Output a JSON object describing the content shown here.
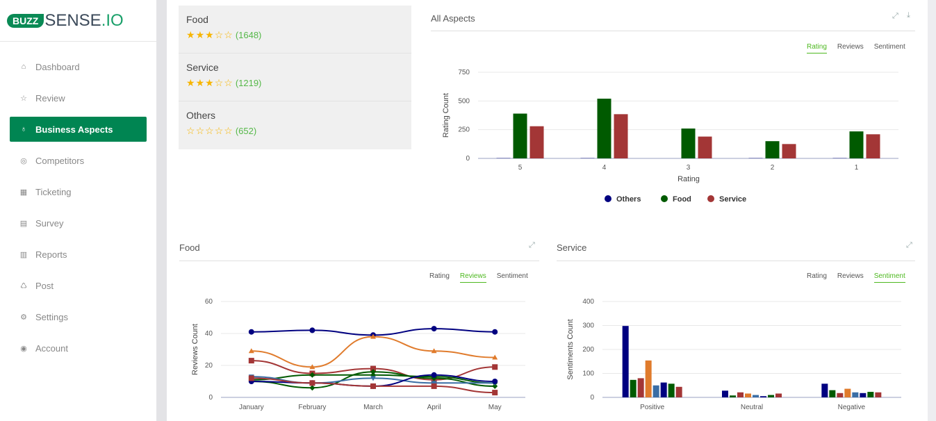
{
  "brand": {
    "badge": "BUZZ",
    "name": "SENSE",
    "tld": ".IO"
  },
  "sidebar": {
    "items": [
      {
        "label": "Dashboard",
        "icon": "home-icon",
        "glyph": "⌂"
      },
      {
        "label": "Review",
        "icon": "star-icon",
        "glyph": "☆"
      },
      {
        "label": "Business Aspects",
        "icon": "lightbulb-icon",
        "glyph": "♁",
        "active": true
      },
      {
        "label": "Competitors",
        "icon": "medal-icon",
        "glyph": "◎"
      },
      {
        "label": "Ticketing",
        "icon": "calculator-icon",
        "glyph": "▦"
      },
      {
        "label": "Survey",
        "icon": "clipboard-icon",
        "glyph": "▤"
      },
      {
        "label": "Reports",
        "icon": "bar-chart-icon",
        "glyph": "▥"
      },
      {
        "label": "Post",
        "icon": "recycle-icon",
        "glyph": "♺"
      },
      {
        "label": "Settings",
        "icon": "gear-icon",
        "glyph": "⚙"
      },
      {
        "label": "Account",
        "icon": "user-circle-icon",
        "glyph": "◉"
      }
    ]
  },
  "aspects": [
    {
      "name": "Food",
      "rating": 3,
      "count": "(1648)"
    },
    {
      "name": "Service",
      "rating": 3,
      "count": "(1219)"
    },
    {
      "name": "Others",
      "rating": 0,
      "count": "(652)"
    }
  ],
  "tab_labels": {
    "rating": "Rating",
    "reviews": "Reviews",
    "sentiment": "Sentiment"
  },
  "panels": {
    "all": {
      "title": "All Aspects",
      "active_tab": "rating"
    },
    "food": {
      "title": "Food",
      "active_tab": "reviews"
    },
    "service": {
      "title": "Service",
      "active_tab": "sentiment"
    }
  },
  "colors": {
    "accent": "#008552",
    "tab_active": "#4db81f",
    "star": "#f7b500"
  },
  "chart_data": [
    {
      "type": "bar",
      "xlabel": "Rating",
      "ylabel": "Rating Count",
      "ylim": [
        0,
        750
      ],
      "yticks": [
        0,
        250,
        500,
        750
      ],
      "grid": true,
      "legend": "bottom",
      "categories": [
        "5",
        "4",
        "3",
        "2",
        "1"
      ],
      "series": [
        {
          "name": "Others",
          "color": "#000080",
          "values": [
            3,
            3,
            0,
            3,
            3
          ]
        },
        {
          "name": "Food",
          "color": "#005a00",
          "values": [
            390,
            520,
            260,
            150,
            235
          ]
        },
        {
          "name": "Service",
          "color": "#a33636",
          "values": [
            280,
            385,
            190,
            125,
            210
          ]
        }
      ]
    },
    {
      "type": "line",
      "ylabel": "Reviews Count",
      "ylim": [
        0,
        60
      ],
      "yticks": [
        0,
        20,
        40,
        60
      ],
      "grid": true,
      "categories": [
        "January",
        "February",
        "March",
        "April",
        "May"
      ],
      "series": [
        {
          "color": "#000080",
          "marker": "circle",
          "values": [
            41,
            42,
            39,
            43,
            41
          ]
        },
        {
          "color": "#e07b2c",
          "marker": "triangle",
          "values": [
            29,
            19,
            38,
            29,
            25
          ]
        },
        {
          "color": "#a33636",
          "marker": "square",
          "values": [
            23,
            15,
            18,
            11,
            19
          ]
        },
        {
          "color": "#005a00",
          "marker": "diamond",
          "values": [
            11,
            14,
            14,
            13,
            9
          ]
        },
        {
          "color": "#005a00",
          "marker": "diamond",
          "values": [
            10,
            6,
            16,
            12,
            7
          ]
        },
        {
          "color": "#3a6ea5",
          "marker": "triangle-down",
          "values": [
            13,
            9,
            12,
            9,
            9
          ]
        },
        {
          "color": "#000080",
          "marker": "circle",
          "values": [
            10,
            9,
            7,
            14,
            10
          ]
        },
        {
          "color": "#a33636",
          "marker": "square",
          "values": [
            12,
            9,
            7,
            7,
            3
          ]
        }
      ]
    },
    {
      "type": "bar",
      "ylabel": "Sentiments Count",
      "ylim": [
        0,
        400
      ],
      "yticks": [
        0,
        100,
        200,
        300,
        400
      ],
      "grid": true,
      "categories": [
        "Positive",
        "Neutral",
        "Negative"
      ],
      "series": [
        {
          "color": "#000080",
          "values": [
            298,
            28,
            57
          ]
        },
        {
          "color": "#005a00",
          "values": [
            73,
            8,
            30
          ]
        },
        {
          "color": "#a33636",
          "values": [
            80,
            21,
            18
          ]
        },
        {
          "color": "#e07b2c",
          "values": [
            154,
            16,
            36
          ]
        },
        {
          "color": "#3a6ea5",
          "values": [
            50,
            10,
            21
          ]
        },
        {
          "color": "#000080",
          "values": [
            62,
            5,
            18
          ]
        },
        {
          "color": "#005a00",
          "values": [
            57,
            10,
            23
          ]
        },
        {
          "color": "#a33636",
          "values": [
            44,
            16,
            21
          ]
        }
      ]
    }
  ]
}
